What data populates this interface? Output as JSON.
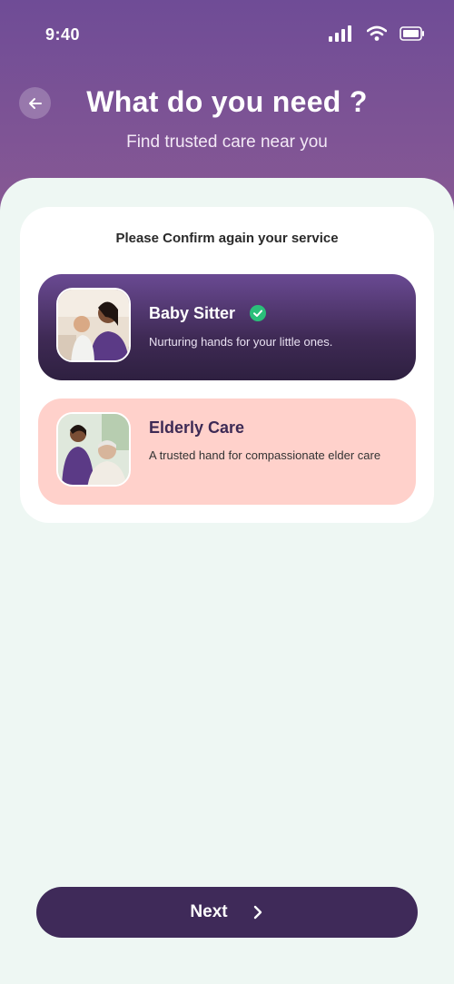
{
  "status_bar": {
    "time": "9:40"
  },
  "header": {
    "title": "What do you need ?",
    "subtitle": "Find trusted care near you"
  },
  "card": {
    "title": "Please Confirm again your service",
    "options": [
      {
        "name": "Baby Sitter",
        "description": "Nurturing hands for your little ones.",
        "selected": true
      },
      {
        "name": "Elderly Care",
        "description": "A trusted hand for compassionate elder care",
        "selected": false
      }
    ]
  },
  "footer": {
    "next_label": "Next"
  },
  "colors": {
    "header_purple": "#6f4c96",
    "selected_card": "#3f2a55",
    "unselected_card": "#ffd1cb",
    "button": "#3f2a59",
    "check_green": "#2bbf7a",
    "background": "#eef7f3"
  }
}
